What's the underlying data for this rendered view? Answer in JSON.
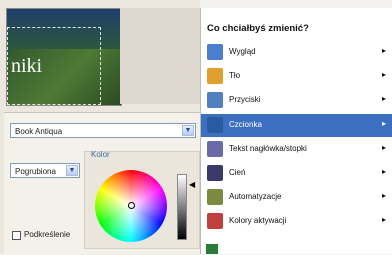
{
  "preview": {
    "title_fragment": "niki"
  },
  "font_panel": {
    "font_family": "Book Antiqua",
    "font_style": "Pogrubiona",
    "color_label": "Kolor",
    "underline_label": "Podkreślenie",
    "underline_checked": false
  },
  "menu": {
    "title": "Co chciałbyś zmienić?",
    "items": [
      {
        "label": "Wygląd",
        "icon": "layout-icon",
        "color": "#4a7fd0"
      },
      {
        "label": "Tło",
        "icon": "background-icon",
        "color": "#e0a030"
      },
      {
        "label": "Przyciski",
        "icon": "buttons-icon",
        "color": "#5080c0"
      },
      {
        "label": "Czcionka",
        "icon": "font-icon",
        "color": "#2a5aa0",
        "selected": true
      },
      {
        "label": "Tekst nagłówka/stopki",
        "icon": "header-text-icon",
        "color": "#6a6aa8"
      },
      {
        "label": "Cień",
        "icon": "shadow-icon",
        "color": "#3a3a6a"
      },
      {
        "label": "Automatyzacje",
        "icon": "automation-icon",
        "color": "#7a8a40"
      },
      {
        "label": "Kolory aktywacji",
        "icon": "activation-colors-icon",
        "color": "#c04040"
      }
    ],
    "arrow": "▸",
    "selected_color": "#3d6fc0"
  }
}
